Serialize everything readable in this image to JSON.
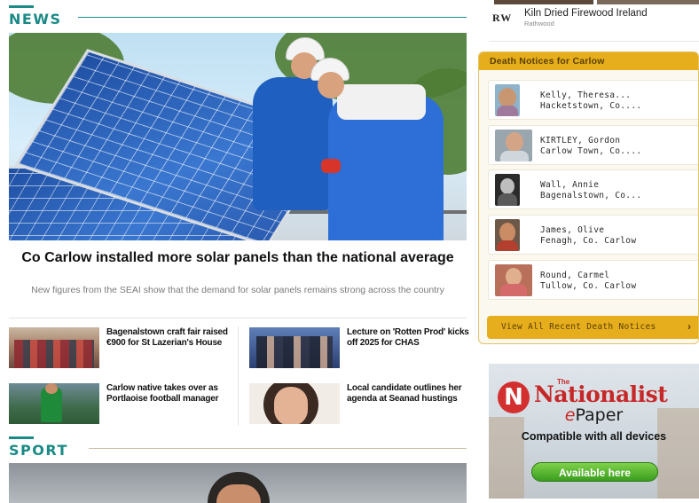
{
  "news_section": {
    "title": "NEWS",
    "lead": {
      "headline": "Co Carlow installed more solar panels than the national average",
      "subline": "New figures from the SEAI show that the demand for solar panels remains strong across the country"
    },
    "stories": [
      {
        "title": "Bagenalstown craft fair raised €900 for St Lazerian's House"
      },
      {
        "title": "Lecture on 'Rotten Prod' kicks off 2025 for CHAS"
      },
      {
        "title": "Carlow native takes over as Portlaoise football manager"
      },
      {
        "title": "Local candidate outlines her agenda at Seanad hustings"
      }
    ]
  },
  "sport_section": {
    "title": "SPORT"
  },
  "sidebar": {
    "advert": {
      "logo_text": "RW",
      "title": "Kiln Dried Firewood Ireland",
      "sub": "Rathwood"
    },
    "death_notices": {
      "title": "Death Notices for Carlow",
      "items": [
        {
          "name": "Kelly, Theresa...",
          "location": "Hacketstown, Co...."
        },
        {
          "name": "KIRTLEY, Gordon",
          "location": "Carlow Town, Co...."
        },
        {
          "name": "Wall, Annie",
          "location": "Bagenalstown, Co..."
        },
        {
          "name": "James, Olive",
          "location": "Fenagh, Co. Carlow"
        },
        {
          "name": "Round, Carmel",
          "location": "Tullow, Co. Carlow"
        }
      ],
      "view_all": "View All Recent Death Notices",
      "chevron": "›"
    },
    "epaper": {
      "logo_letter": "N",
      "the": "The",
      "brand": "Nationalist",
      "title_e": "e",
      "title_rest": "Paper",
      "compat": "Compatible with all devices",
      "button": "Available here"
    }
  },
  "colors": {
    "accent_teal": "#1a8a86",
    "death_gold": "#e6ae1c",
    "nationalist_red": "#c62828",
    "button_green": "#3a9d1e"
  }
}
